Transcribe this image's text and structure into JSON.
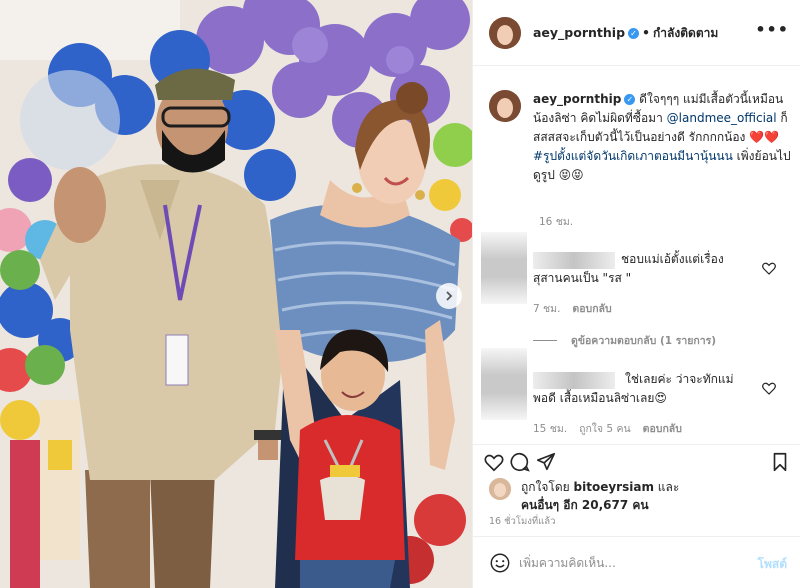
{
  "header": {
    "username": "aey_pornthip",
    "separator": "•",
    "follow_status": "กำลังติดตาม",
    "more_icon": "more-horizontal-icon"
  },
  "caption": {
    "username": "aey_pornthip",
    "text_1": "ดีใจๆๆๆ แม่มีเสื้อตัวนี้เหมือนน้องลิซ่า คิดไม่ผิดที่ซื้อมา",
    "mention": "@landmee_official",
    "text_2": "ก็สสสสจะเก็บตัวนี้ไว้เป็นอย่างดี รักกกกน้อง ❤️❤️",
    "hashtag": "#รูปตั้งแต่จัดวันเกิดเภาตอนมีนานุ้นนน",
    "text_3": "เพิ่งย้อนไปดูรูป 😝😝",
    "time": "16 ชม."
  },
  "comments": [
    {
      "text": "ชอบแม่เอ้ตั้งแต่เรื่อง สุสานคนเป็น \"รส \"",
      "time": "7 ชม.",
      "reply_label": "ตอบกลับ",
      "view_replies": "ดูข้อความตอบกลับ (1 รายการ)"
    },
    {
      "text": "ใช่เลยค่ะ ว่าจะทักแม่พอดี เสื้อเหมือนลิซ่าเลย😍",
      "time": "15 ชม.",
      "likes": "ถูกใจ 5 คน",
      "reply_label": "ตอบกลับ"
    }
  ],
  "likes": {
    "prefix": "ถูกใจโดย",
    "first_user": "bitoeyrsiam",
    "conj": "และ",
    "others": "คนอื่นๆ อีก 20,677 คน"
  },
  "post_time": "16 ชั่วโมงที่แล้ว",
  "add_comment": {
    "placeholder": "เพิ่มความคิดเห็น...",
    "post_label": "โพสต์"
  },
  "colors": {
    "link": "#00376b",
    "verified": "#3897f0",
    "heart": "#ed4956",
    "muted": "#8e8e8e"
  }
}
